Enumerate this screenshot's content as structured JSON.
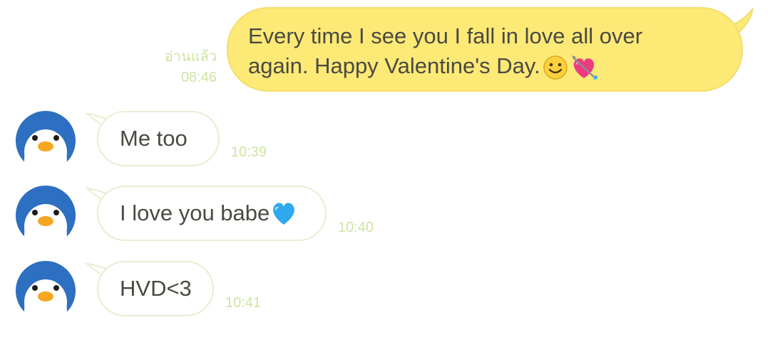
{
  "sent_message": {
    "text": "Every time I see you I fall in love all over again. Happy Valentine's Day.",
    "emojis": [
      "smiling-face-emoji",
      "heart-with-arrow-emoji"
    ],
    "read_status": "อ่านแล้ว",
    "time": "08:46"
  },
  "received_messages": [
    {
      "text": "Me too",
      "time": "10:39"
    },
    {
      "text": "I love you babe",
      "emoji": "blue-heart-emoji",
      "time": "10:40"
    },
    {
      "text": "HVD<3",
      "time": "10:41"
    }
  ],
  "colors": {
    "sent_bubble": "#fde976",
    "received_border": "#e6efcf",
    "meta_text": "#cfe3a5",
    "avatar_blue": "#2d6fc1",
    "beak_orange": "#f5a623"
  }
}
